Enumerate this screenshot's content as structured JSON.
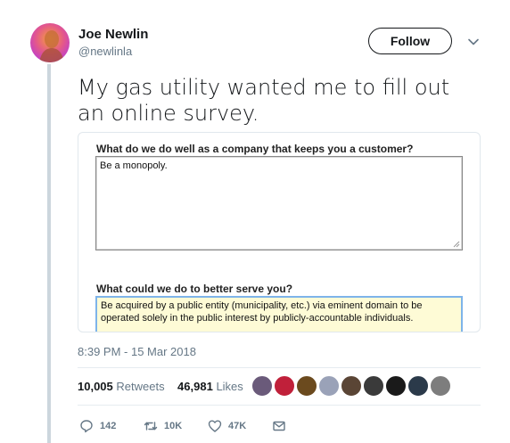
{
  "author": {
    "name": "Joe Newlin",
    "handle": "@newlinla"
  },
  "follow_label": "Follow",
  "tweet": {
    "text": "My gas utility wanted me to fill out an online survey."
  },
  "screenshot": {
    "question1": "What do we do well as a company that keeps you a customer?",
    "answer1": "Be a monopoly.",
    "question2": "What could we do to better serve you?",
    "answer2": "Be acquired by a public entity (municipality, etc.) via eminent domain to be operated solely in the public interest by publicly-accountable individuals."
  },
  "timestamp": "8:39 PM - 15 Mar 2018",
  "stats": {
    "retweets_count": "10,005",
    "retweets_label": "Retweets",
    "likes_count": "46,981",
    "likes_label": "Likes"
  },
  "liker_colors": [
    "#6a5a7a",
    "#c0203a",
    "#6b4a1e",
    "#9aa2b8",
    "#5a4535",
    "#3a3a3a",
    "#1a1a1a",
    "#2b3a4a",
    "#7d7d7d"
  ],
  "actions": {
    "replies": "142",
    "retweets": "10K",
    "likes": "47K"
  },
  "colors": {
    "text": "#14171a",
    "secondary": "#657786",
    "border": "#e6ecf0",
    "input_focus": "#7eb4ea",
    "autofill": "#fefbd6"
  }
}
